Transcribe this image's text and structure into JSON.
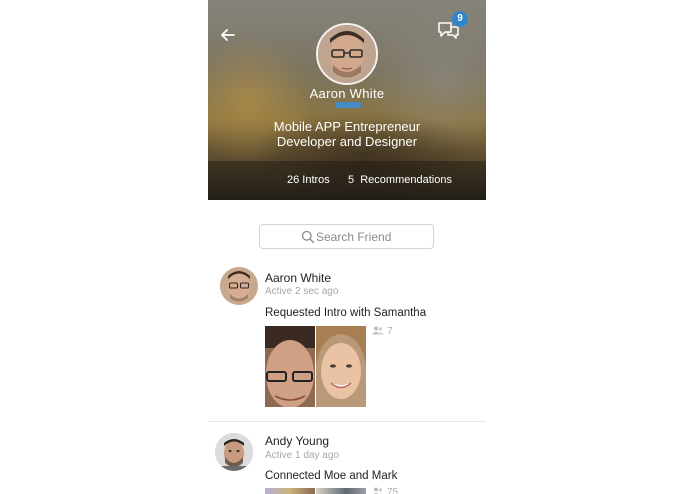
{
  "profile": {
    "name": "Aaron White",
    "bio_line1": "Mobile APP Entrepreneur",
    "bio_line2": "Developer and Designer",
    "stats": {
      "intros": "26 Intros",
      "recommendations": "5  Recommendations"
    },
    "notification_count": "9"
  },
  "search": {
    "placeholder": "Search Friend"
  },
  "feed": [
    {
      "name": "Aaron White",
      "active": "Active 2 sec ago",
      "action": "Requested Intro with Samantha",
      "count": "7"
    },
    {
      "name": "Andy Young",
      "active": "Active 1 day ago",
      "action": "Connected Moe and Mark",
      "count": "75"
    }
  ],
  "colors": {
    "accent": "#2d86c9",
    "muted": "#a7a7a7"
  },
  "icons": [
    "back-arrow-icon",
    "chat-bubbles-icon",
    "search-icon",
    "people-icon"
  ]
}
